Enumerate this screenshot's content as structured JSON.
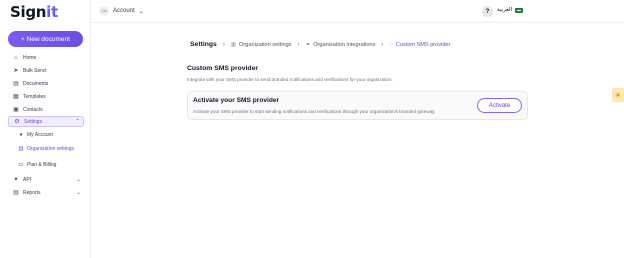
{
  "brand": {
    "logo_main": "Sign",
    "logo_accent": "it"
  },
  "sidebar": {
    "new_document": "+ New document",
    "items": [
      {
        "label": "Home",
        "icon": "home-icon"
      },
      {
        "label": "Bulk Send",
        "icon": "send-icon"
      },
      {
        "label": "Documents",
        "icon": "document-icon"
      },
      {
        "label": "Templates",
        "icon": "template-icon"
      },
      {
        "label": "Contacts",
        "icon": "contacts-icon"
      },
      {
        "label": "Settings",
        "icon": "settings-icon"
      },
      {
        "label": "API",
        "icon": "api-icon"
      },
      {
        "label": "Reports",
        "icon": "reports-icon"
      }
    ],
    "settings_sub": [
      {
        "label": "My Account",
        "icon": "user-icon"
      },
      {
        "label": "Organization settings",
        "icon": "building-icon"
      },
      {
        "label": "Plan & Billing",
        "icon": "billing-icon"
      }
    ]
  },
  "topbar": {
    "avatar_initials": "CA",
    "account_label": "Account",
    "help": "?",
    "language": "العربية"
  },
  "breadcrumb": {
    "root": "Settings",
    "items": [
      "Organization settings",
      "Organization integrations",
      "Custom SMS provider"
    ]
  },
  "content": {
    "title": "Custom SMS provider",
    "description": "Integrate with your SMS provider to send branded notifications and verifications for your organization.",
    "card": {
      "title": "Activate your SMS provider",
      "description": "Activate your SMS provider to start sending notifications and verifications through your organization's branded gateway.",
      "button": "Activate"
    }
  },
  "colors": {
    "accent": "#6d5dfc",
    "active_bg": "#f1efff"
  }
}
